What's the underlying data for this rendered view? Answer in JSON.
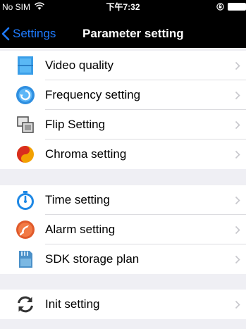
{
  "status_bar": {
    "carrier": "No SIM",
    "time": "下午7:32"
  },
  "nav": {
    "back_label": "Settings",
    "title": "Parameter setting"
  },
  "sections": [
    {
      "items": [
        {
          "label": "Video quality",
          "icon": "video-quality-icon"
        },
        {
          "label": "Frequency setting",
          "icon": "frequency-icon"
        },
        {
          "label": "Flip Setting",
          "icon": "flip-icon"
        },
        {
          "label": "Chroma setting",
          "icon": "chroma-icon"
        }
      ]
    },
    {
      "items": [
        {
          "label": "Time setting",
          "icon": "stopwatch-icon"
        },
        {
          "label": "Alarm setting",
          "icon": "alarm-icon"
        },
        {
          "label": "SDK storage plan",
          "icon": "sd-card-icon"
        }
      ]
    },
    {
      "items": [
        {
          "label": "Init setting",
          "icon": "refresh-icon"
        }
      ]
    }
  ],
  "colors": {
    "accent": "#1e7bff",
    "background": "#efeff4",
    "navbar": "#000000"
  }
}
